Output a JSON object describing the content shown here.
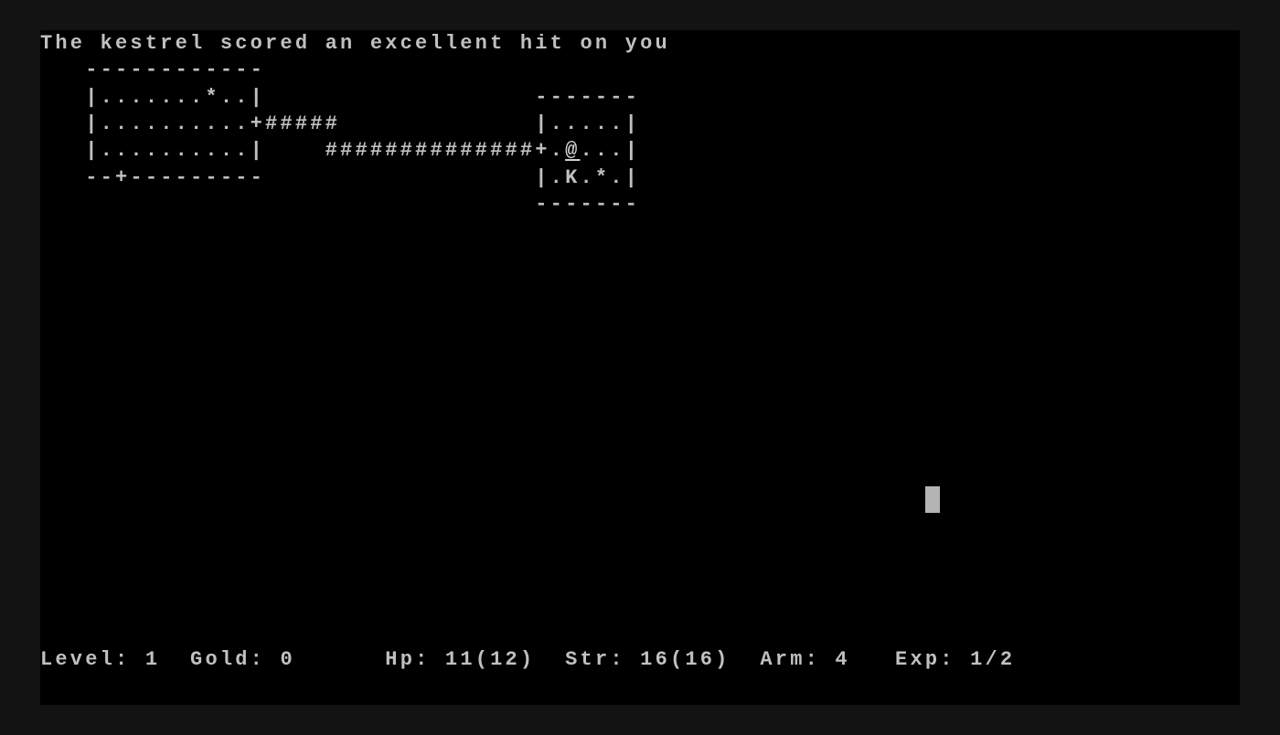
{
  "window": {
    "frame_color": "#131313",
    "terminal_bg": "#000000",
    "text_color": "#c0c0c0",
    "cursor_color": "#b4b4b4"
  },
  "message": "The kestrel scored an excellent hit on you",
  "map": {
    "rows": [
      {
        "row": 1,
        "text": "   ------------"
      },
      {
        "row": 2,
        "text": "   |.......*..|                  -------"
      },
      {
        "row": 3,
        "text": "   |..........+#####             |.....|"
      },
      {
        "row": 4,
        "prefix": "   |..........|    ##############+.",
        "player": "@",
        "suffix": "...|"
      },
      {
        "row": 5,
        "text": "   --+---------                  |.K.*.|"
      },
      {
        "row": 6,
        "text": "                                 -------"
      }
    ],
    "legend": {
      "player": "@",
      "monster_kestrel": "K",
      "item_gold_or_gem": "*",
      "door": "+",
      "corridor": "#",
      "floor": ".",
      "wall_vertical": "|",
      "wall_horizontal": "-"
    }
  },
  "status": {
    "level_label": "Level:",
    "level": "1",
    "gold_label": "Gold:",
    "gold": "0",
    "hp_label": "Hp:",
    "hp": "11(12)",
    "str_label": "Str:",
    "str": "16(16)",
    "arm_label": "Arm:",
    "arm": "4",
    "exp_label": "Exp:",
    "exp": "1/2"
  }
}
